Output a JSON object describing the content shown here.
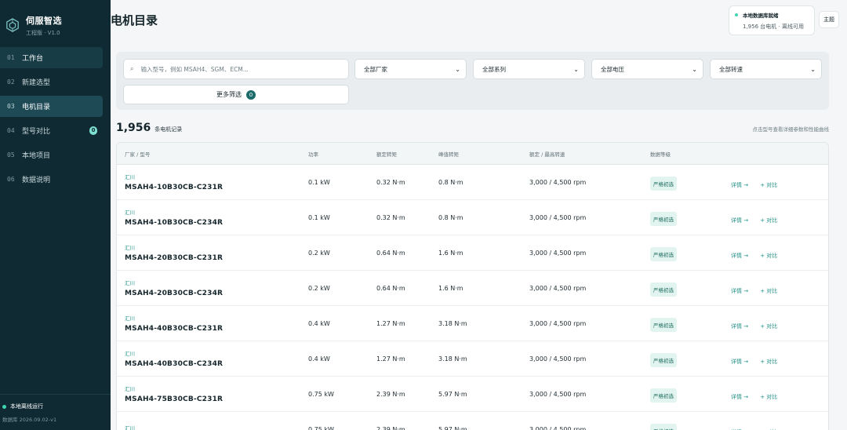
{
  "brand": {
    "title": "伺服智选",
    "subtitle": "工程版 · V1.0"
  },
  "nav": [
    {
      "num": "01",
      "label": "工作台",
      "state": "hover"
    },
    {
      "num": "02",
      "label": "新建选型",
      "state": ""
    },
    {
      "num": "03",
      "label": "电机目录",
      "state": "active"
    },
    {
      "num": "04",
      "label": "型号对比",
      "state": "",
      "badge": "0"
    },
    {
      "num": "05",
      "label": "本地项目",
      "state": ""
    },
    {
      "num": "06",
      "label": "数据说明",
      "state": ""
    }
  ],
  "footer": {
    "status": "本地离线运行",
    "db": "数据库 2026.09.02-v1"
  },
  "header": {
    "title": "电机目录",
    "db_status_title": "本地数据库就绪",
    "db_status_detail": "1,956 台电机 · 离线可用",
    "theme_label": "主题"
  },
  "filters": {
    "search_placeholder": "输入型号，例如 MSAH4、SGM、ECM...",
    "maker": "全部厂家",
    "series": "全部系列",
    "voltage": "全部电压",
    "speed": "全部转速",
    "more_label": "更多筛选",
    "more_count": "0"
  },
  "summary": {
    "count": "1,956",
    "unit": "条电机记录",
    "hint": "点击型号查看详细参数和性能曲线"
  },
  "table": {
    "headers": [
      "厂家 / 型号",
      "功率",
      "额定转矩",
      "峰值转矩",
      "额定 / 最高转速",
      "数据等级",
      ""
    ],
    "detail_label": "详情 →",
    "compare_label": "+ 对比",
    "rows": [
      {
        "maker": "汇川",
        "model": "MSAH4-10B30CB-C231R",
        "power": "0.1 kW",
        "rated": "0.32 N·m",
        "peak": "0.8 N·m",
        "speed": "3,000 / 4,500 rpm",
        "grade": "严格初选"
      },
      {
        "maker": "汇川",
        "model": "MSAH4-10B30CB-C234R",
        "power": "0.1 kW",
        "rated": "0.32 N·m",
        "peak": "0.8 N·m",
        "speed": "3,000 / 4,500 rpm",
        "grade": "严格初选"
      },
      {
        "maker": "汇川",
        "model": "MSAH4-20B30CB-C231R",
        "power": "0.2 kW",
        "rated": "0.64 N·m",
        "peak": "1.6 N·m",
        "speed": "3,000 / 4,500 rpm",
        "grade": "严格初选"
      },
      {
        "maker": "汇川",
        "model": "MSAH4-20B30CB-C234R",
        "power": "0.2 kW",
        "rated": "0.64 N·m",
        "peak": "1.6 N·m",
        "speed": "3,000 / 4,500 rpm",
        "grade": "严格初选"
      },
      {
        "maker": "汇川",
        "model": "MSAH4-40B30CB-C231R",
        "power": "0.4 kW",
        "rated": "1.27 N·m",
        "peak": "3.18 N·m",
        "speed": "3,000 / 4,500 rpm",
        "grade": "严格初选"
      },
      {
        "maker": "汇川",
        "model": "MSAH4-40B30CB-C234R",
        "power": "0.4 kW",
        "rated": "1.27 N·m",
        "peak": "3.18 N·m",
        "speed": "3,000 / 4,500 rpm",
        "grade": "严格初选"
      },
      {
        "maker": "汇川",
        "model": "MSAH4-75B30CB-C231R",
        "power": "0.75 kW",
        "rated": "2.39 N·m",
        "peak": "5.97 N·m",
        "speed": "3,000 / 4,500 rpm",
        "grade": "严格初选"
      },
      {
        "maker": "汇川",
        "model": "",
        "power": "0.75 kW",
        "rated": "2.39 N·m",
        "peak": "5.97 N·m",
        "speed": "3,000 / 4,500 rpm",
        "grade": "严格初选"
      }
    ]
  },
  "colors": {
    "sidebar_bg": "#0f2a33",
    "accent": "#1f8f86",
    "grade_bg": "#e2f4ef"
  }
}
